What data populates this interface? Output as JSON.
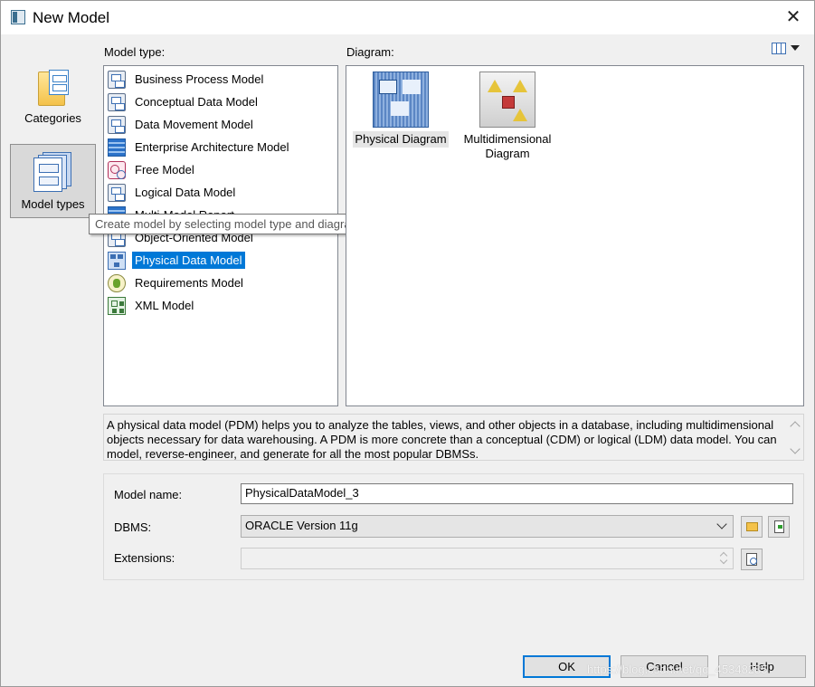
{
  "window": {
    "title": "New Model",
    "close_glyph": "✕"
  },
  "categories_panel": {
    "items": [
      {
        "label": "Categories",
        "icon": "categories-folder-icon",
        "selected": false
      },
      {
        "label": "Model types",
        "icon": "model-types-icon",
        "selected": true
      }
    ]
  },
  "model_type": {
    "label": "Model type:",
    "items": [
      {
        "label": "Business Process Model",
        "icon": "business-process-model-icon"
      },
      {
        "label": "Conceptual Data Model",
        "icon": "conceptual-data-model-icon"
      },
      {
        "label": "Data Movement Model",
        "icon": "data-movement-model-icon"
      },
      {
        "label": "Enterprise Architecture Model",
        "icon": "enterprise-architecture-model-icon"
      },
      {
        "label": "Free Model",
        "icon": "free-model-icon"
      },
      {
        "label": "Logical Data Model",
        "icon": "logical-data-model-icon"
      },
      {
        "label": "Multi-Model Report",
        "icon": "multi-model-report-icon"
      },
      {
        "label": "Object-Oriented Model",
        "icon": "object-oriented-model-icon"
      },
      {
        "label": "Physical Data Model",
        "icon": "physical-data-model-icon",
        "selected": true
      },
      {
        "label": "Requirements Model",
        "icon": "requirements-model-icon"
      },
      {
        "label": "XML Model",
        "icon": "xml-model-icon"
      }
    ]
  },
  "tooltip": {
    "text": "Create model by selecting model type and diagram"
  },
  "diagram": {
    "label": "Diagram:",
    "view_toggle_icon": "list-view-icon",
    "items": [
      {
        "label": "Physical Diagram",
        "icon": "physical-diagram-icon",
        "selected": true
      },
      {
        "label": "Multidimensional Diagram",
        "icon": "multidimensional-diagram-icon",
        "selected": false
      }
    ]
  },
  "description": {
    "text": "A physical data model (PDM) helps you to analyze the tables, views, and other objects in a database, including multidimensional objects necessary for data warehousing. A PDM is more concrete than a conceptual (CDM) or logical (LDM) data model. You can model, reverse-engineer, and generate for all the most popular DBMSs."
  },
  "properties": {
    "model_name_label": "Model name:",
    "model_name_value": "PhysicalDataModel_3",
    "dbms_label": "DBMS:",
    "dbms_value": "ORACLE Version 11g",
    "extensions_label": "Extensions:",
    "extensions_value": ""
  },
  "buttons": {
    "ok": "OK",
    "cancel": "Cancel",
    "help": "Help"
  },
  "watermark": {
    "text": "https://blog.csdn.net/qq_45348285"
  },
  "colors": {
    "selection": "#0078d7",
    "dialog_background": "#f0f0f0"
  }
}
